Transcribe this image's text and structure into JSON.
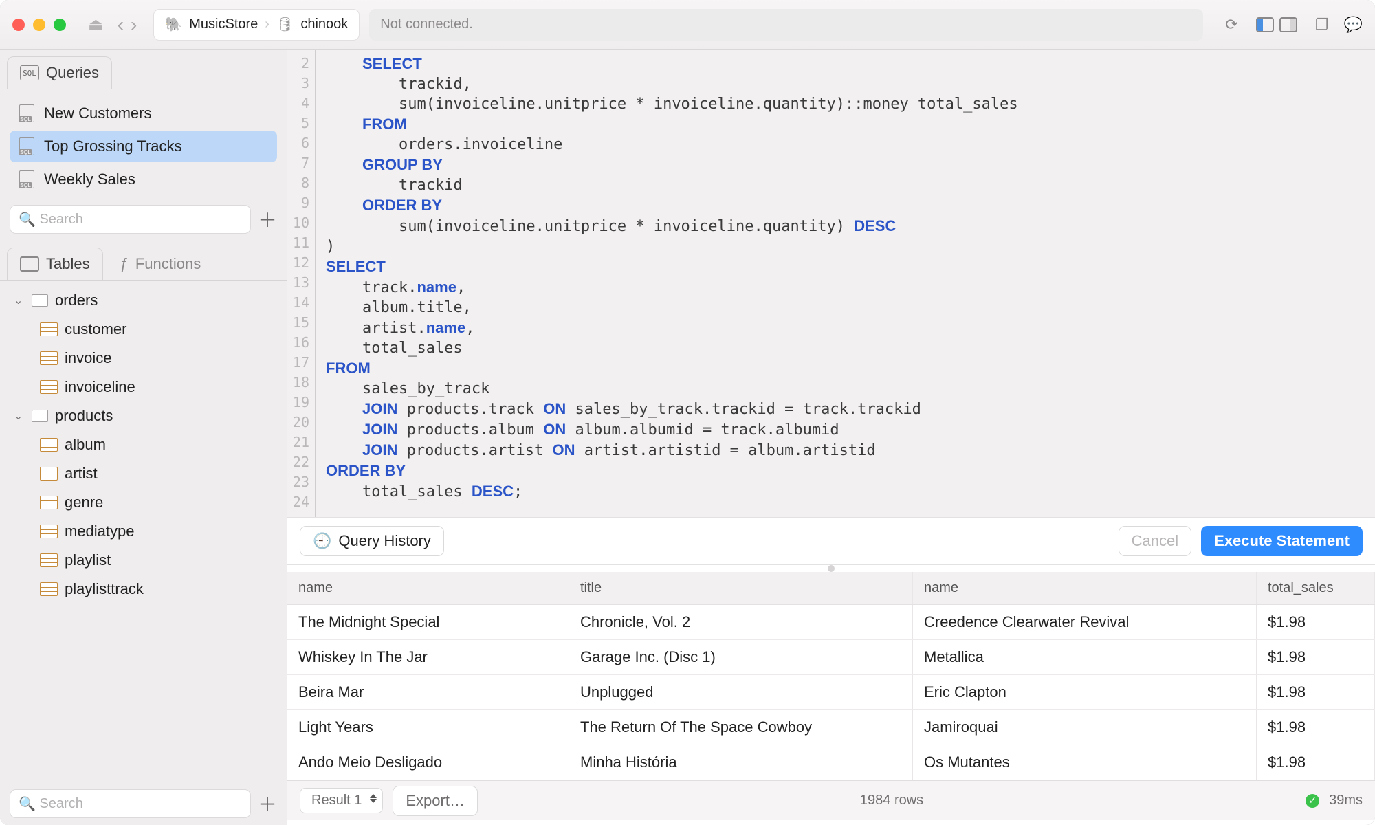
{
  "breadcrumb": {
    "app": "MusicStore",
    "db": "chinook"
  },
  "status": "Not connected.",
  "sidebar": {
    "queries_tab": "Queries",
    "tables_tab": "Tables",
    "functions_tab": "Functions",
    "search_placeholder": "Search",
    "queries": [
      {
        "label": "New Customers"
      },
      {
        "label": "Top Grossing Tracks"
      },
      {
        "label": "Weekly Sales"
      }
    ],
    "schemas": [
      {
        "name": "orders",
        "tables": [
          "customer",
          "invoice",
          "invoiceline"
        ]
      },
      {
        "name": "products",
        "tables": [
          "album",
          "artist",
          "genre",
          "mediatype",
          "playlist",
          "playlisttrack"
        ]
      }
    ]
  },
  "editor": {
    "lines_start": 2,
    "lines_end": 24,
    "code_html": "    <span class='kw'>SELECT</span>\n        trackid,\n        sum(invoiceline.unitprice * invoiceline.quantity)::money total_sales\n    <span class='kw'>FROM</span>\n        orders.invoiceline\n    <span class='kw'>GROUP BY</span>\n        trackid\n    <span class='kw'>ORDER BY</span>\n        sum(invoiceline.unitprice * invoiceline.quantity) <span class='kw'>DESC</span>\n)\n<span class='kw'>SELECT</span>\n    track.<span class='kw'>name</span>,\n    album.title,\n    artist.<span class='kw'>name</span>,\n    total_sales\n<span class='kw'>FROM</span>\n    sales_by_track\n    <span class='kw'>JOIN</span> products.track <span class='kw'>ON</span> sales_by_track.trackid = track.trackid\n    <span class='kw'>JOIN</span> products.album <span class='kw'>ON</span> album.albumid = track.albumid\n    <span class='kw'>JOIN</span> products.artist <span class='kw'>ON</span> artist.artistid = album.artistid\n<span class='kw'>ORDER BY</span>\n    total_sales <span class='kw'>DESC</span>;\n"
  },
  "execbar": {
    "history": "Query History",
    "cancel": "Cancel",
    "execute": "Execute Statement"
  },
  "results": {
    "columns": [
      "name",
      "title",
      "name",
      "total_sales"
    ],
    "rows": [
      [
        "The Midnight Special",
        "Chronicle, Vol. 2",
        "Creedence Clearwater Revival",
        "$1.98"
      ],
      [
        "Whiskey In The Jar",
        "Garage Inc. (Disc 1)",
        "Metallica",
        "$1.98"
      ],
      [
        "Beira Mar",
        "Unplugged",
        "Eric Clapton",
        "$1.98"
      ],
      [
        "Light Years",
        "The Return Of The Space Cowboy",
        "Jamiroquai",
        "$1.98"
      ],
      [
        "Ando Meio Desligado",
        "Minha História",
        "Os Mutantes",
        "$1.98"
      ]
    ]
  },
  "footer": {
    "result_tab": "Result 1",
    "export": "Export…",
    "rows": "1984 rows",
    "time": "39ms"
  }
}
